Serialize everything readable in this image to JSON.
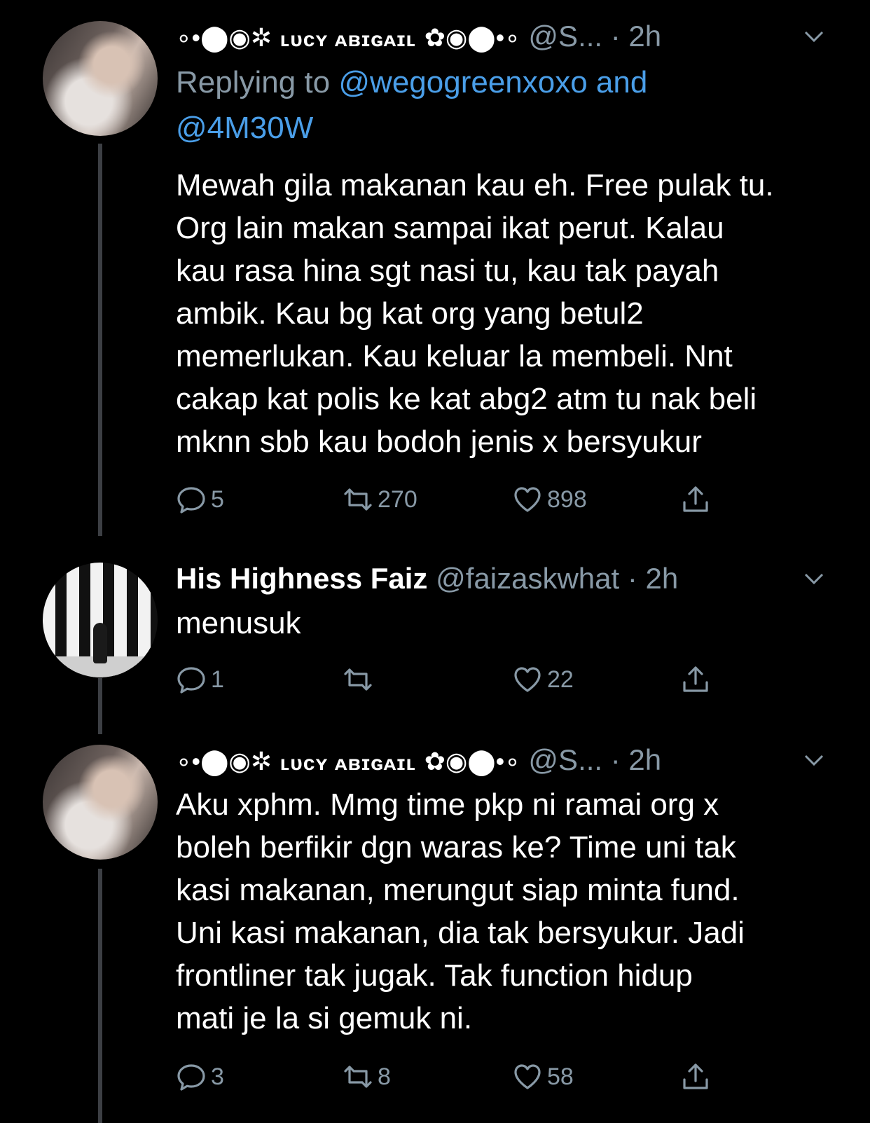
{
  "tweets": [
    {
      "display_name": "ʟᴜᴄʏ ᴀʙɪɢᴀɪʟ",
      "prefix_deco": "∘•⬤◉✲",
      "suffix_deco": "✿◉⬤•∘",
      "handle": "@S...",
      "time": "· 2h",
      "replying_prefix": "Replying to",
      "replying_mentions": "@wegogreenxoxo and",
      "replying_mentions_2": "@4M30W",
      "text": "Mewah gila makanan kau eh. Free pulak tu.\nOrg lain makan sampai ikat perut. Kalau\nkau rasa hina sgt nasi tu, kau tak payah\nambik. Kau bg kat org yang betul2\nmemerlukan. Kau keluar la membeli. Nnt\ncakap kat polis ke kat abg2 atm tu nak beli\nmknn sbb kau bodoh jenis x bersyukur",
      "reply_count": "5",
      "retweet_count": "270",
      "like_count": "898"
    },
    {
      "display_name": "His Highness Faiz",
      "handle": "@faizaskwhat",
      "time": "· 2h",
      "text": "menusuk",
      "reply_count": "1",
      "retweet_count": "",
      "like_count": "22"
    },
    {
      "display_name": "ʟᴜᴄʏ ᴀʙɪɢᴀɪʟ",
      "prefix_deco": "∘•⬤◉✲",
      "suffix_deco": "✿◉⬤•∘",
      "handle": "@S...",
      "time": "· 2h",
      "text": "Aku xphm. Mmg time pkp ni ramai org x\nboleh berfikir dgn waras ke? Time uni tak\nkasi makanan, merungut siap minta fund.\nUni kasi makanan, dia tak bersyukur. Jadi\nfrontliner tak jugak. Tak function hidup\nmati je la si gemuk ni.",
      "reply_count": "3",
      "retweet_count": "8",
      "like_count": "58"
    }
  ],
  "icons": {
    "reply": "reply-icon",
    "retweet": "retweet-icon",
    "like": "heart-icon",
    "share": "share-icon",
    "more": "chevron-down-icon"
  },
  "colors": {
    "background": "#000000",
    "text": "#ffffff",
    "secondary": "#8899a6",
    "link": "#4a9ee8",
    "thread_line": "#3c3f44"
  }
}
